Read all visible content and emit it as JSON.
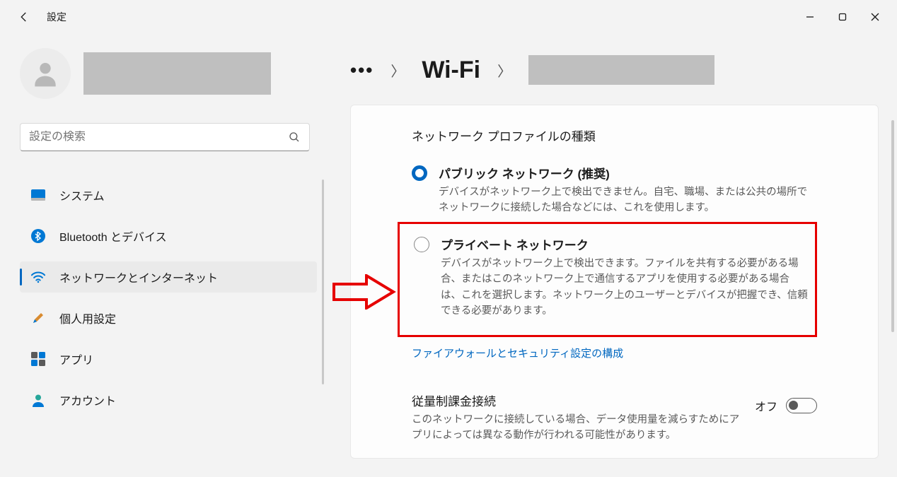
{
  "titlebar": {
    "title": "設定"
  },
  "search": {
    "placeholder": "設定の検索"
  },
  "sidebar": {
    "items": [
      {
        "label": "システム"
      },
      {
        "label": "Bluetooth とデバイス"
      },
      {
        "label": "ネットワークとインターネット"
      },
      {
        "label": "個人用設定"
      },
      {
        "label": "アプリ"
      },
      {
        "label": "アカウント"
      }
    ]
  },
  "breadcrumb": {
    "wifi": "Wi-Fi"
  },
  "section": {
    "title": "ネットワーク プロファイルの種類",
    "public": {
      "title": "パブリック ネットワーク (推奨)",
      "desc": "デバイスがネットワーク上で検出できません。自宅、職場、または公共の場所でネットワークに接続した場合などには、これを使用します。"
    },
    "private": {
      "title": "プライベート ネットワーク",
      "desc": "デバイスがネットワーク上で検出できます。ファイルを共有する必要がある場合、またはこのネットワーク上で通信するアプリを使用する必要がある場合は、これを選択します。ネットワーク上のユーザーとデバイスが把握でき、信頼できる必要があります。"
    },
    "firewall_link": "ファイアウォールとセキュリティ設定の構成"
  },
  "metered": {
    "title": "従量制課金接続",
    "desc": "このネットワークに接続している場合、データ使用量を減らすためにアプリによっては異なる動作が行われる可能性があります。",
    "state_label": "オフ"
  }
}
